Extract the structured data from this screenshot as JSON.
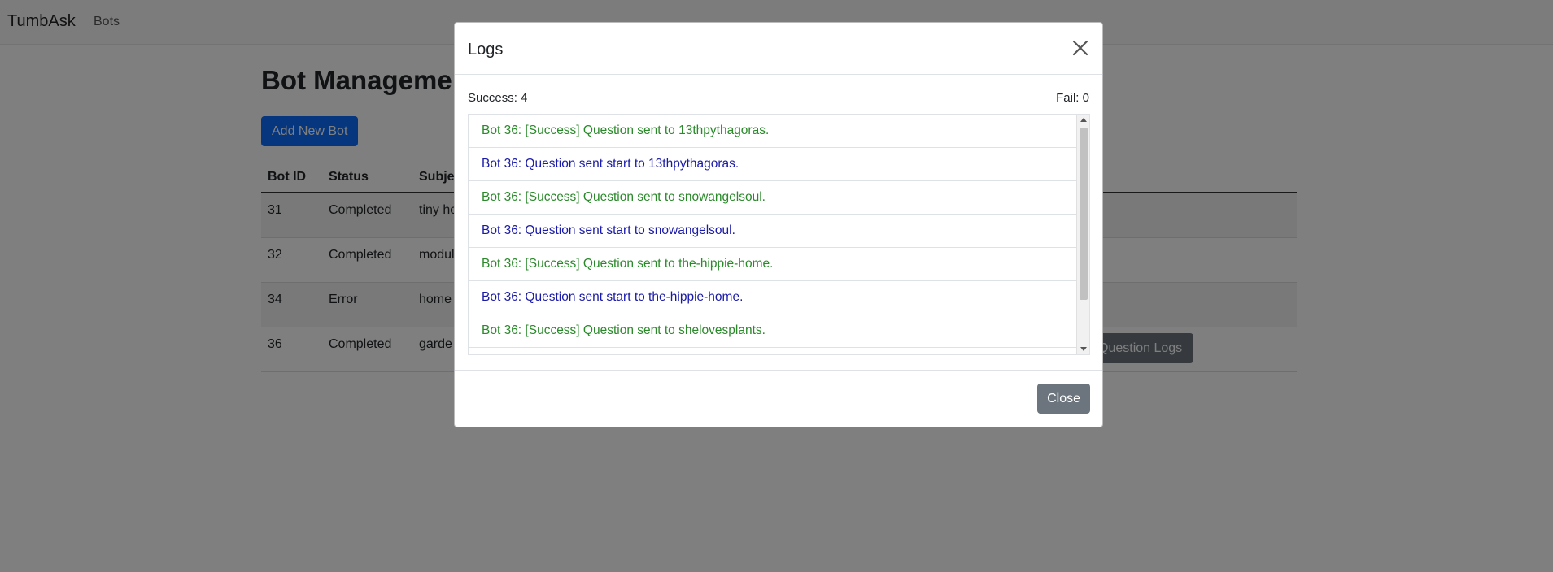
{
  "navbar": {
    "brand": "TumbAsk",
    "link": "Bots"
  },
  "page": {
    "title": "Bot Management",
    "add_button": "Add New Bot",
    "table": {
      "headers": [
        "Bot ID",
        "Status",
        "Subject"
      ],
      "rows": [
        {
          "id": "31",
          "status": "Completed",
          "subject": "tiny ho"
        },
        {
          "id": "32",
          "status": "Completed",
          "subject": "modul"
        },
        {
          "id": "34",
          "status": "Error",
          "subject": "home"
        },
        {
          "id": "36",
          "status": "Completed",
          "subject": "garde"
        }
      ],
      "row_button": "Question Logs"
    }
  },
  "modal": {
    "title": "Logs",
    "success_label": "Success: 4",
    "fail_label": "Fail: 0",
    "logs": [
      {
        "text": "Bot 36: [Success] Question sent to 13thpythagoras.",
        "kind": "success"
      },
      {
        "text": "Bot 36: Question sent start to 13thpythagoras.",
        "kind": "start"
      },
      {
        "text": "Bot 36: [Success] Question sent to snowangelsoul.",
        "kind": "success"
      },
      {
        "text": "Bot 36: Question sent start to snowangelsoul.",
        "kind": "start"
      },
      {
        "text": "Bot 36: [Success] Question sent to the-hippie-home.",
        "kind": "success"
      },
      {
        "text": "Bot 36: Question sent start to the-hippie-home.",
        "kind": "start"
      },
      {
        "text": "Bot 36: [Success] Question sent to shelovesplants.",
        "kind": "success"
      }
    ],
    "close_button": "Close"
  },
  "colors": {
    "success": "#2a8a2a",
    "start": "#1a1aa8",
    "primary": "#0d6efd",
    "secondary": "#6c757d"
  }
}
